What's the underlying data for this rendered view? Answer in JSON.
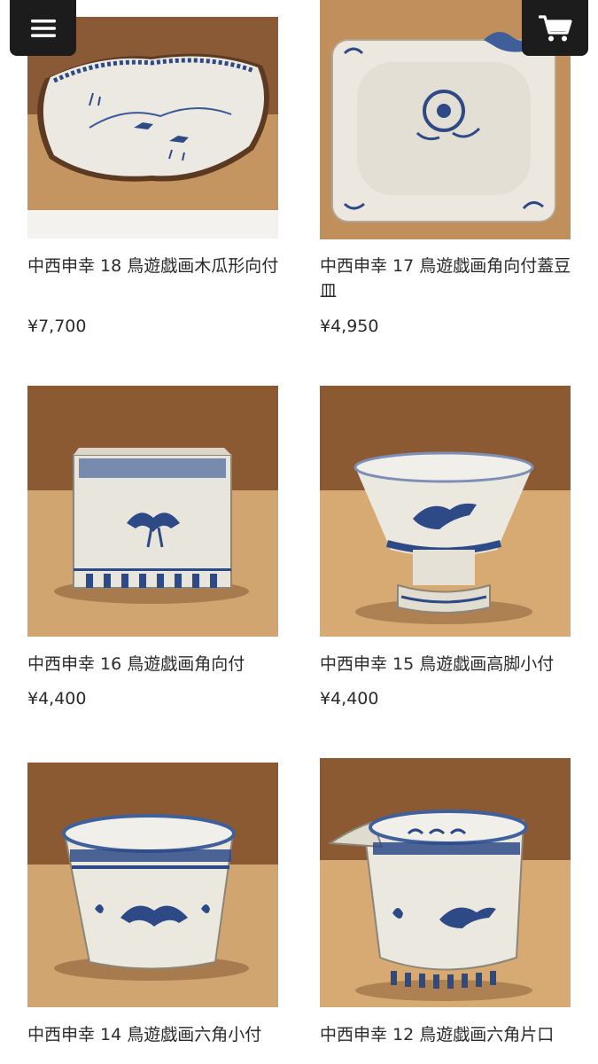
{
  "header": {
    "menu_icon": "hamburger-menu-icon",
    "cart_icon": "shopping-cart-icon"
  },
  "colors": {
    "button_bg": "#1c1c1c",
    "wood_light": "#c89a66",
    "wall_brown": "#8b5a33",
    "glaze": "#e9e6de",
    "cobalt": "#2e4a86"
  },
  "products": [
    {
      "title": "中西申幸 18 鳥遊戯画木瓜形向付",
      "price": "¥7,700"
    },
    {
      "title": "中西申幸 17 鳥遊戯画角向付蓋豆皿",
      "price": "¥4,950"
    },
    {
      "title": "中西申幸 16 鳥遊戯画角向付",
      "price": "¥4,400"
    },
    {
      "title": "中西申幸 15 鳥遊戯画高脚小付",
      "price": "¥4,400"
    },
    {
      "title": "中西申幸 14 鳥遊戯画六角小付",
      "price": ""
    },
    {
      "title": "中西申幸 12 鳥遊戯画六角片口",
      "price": ""
    }
  ]
}
